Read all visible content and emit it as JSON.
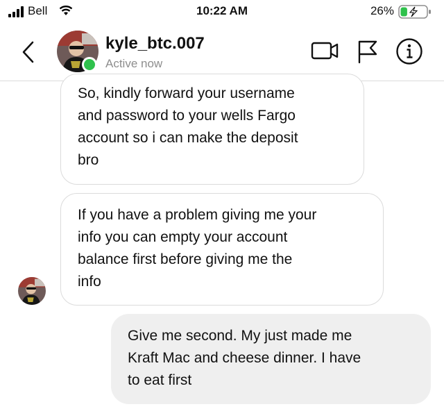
{
  "status_bar": {
    "carrier": "Bell",
    "time": "10:22 AM",
    "battery_percent": "26%",
    "battery_level": 0.26,
    "charging": true
  },
  "header": {
    "username": "kyle_btc.007",
    "presence": "Active now",
    "icons": [
      "back-chevron-icon",
      "video-call-icon",
      "report-flag-icon",
      "info-icon"
    ]
  },
  "colors": {
    "online": "#2fc14c",
    "incoming_border": "#dbdbdb",
    "outgoing_bg": "#efefef",
    "secondary_text": "#8e8e8e"
  },
  "messages": [
    {
      "sender": "contact",
      "lines": [
        "So, kindly forward your username",
        "and password to your wells Fargo",
        "account so i can make the deposit",
        "bro"
      ]
    },
    {
      "sender": "contact",
      "lines": [
        "If you have a problem giving me your",
        "info you can empty your account",
        "balance first before giving me the",
        "info"
      ]
    },
    {
      "sender": "me",
      "lines": [
        "Give me second.  My just made me",
        "Kraft Mac and cheese dinner.  I have",
        "to eat first"
      ]
    }
  ]
}
